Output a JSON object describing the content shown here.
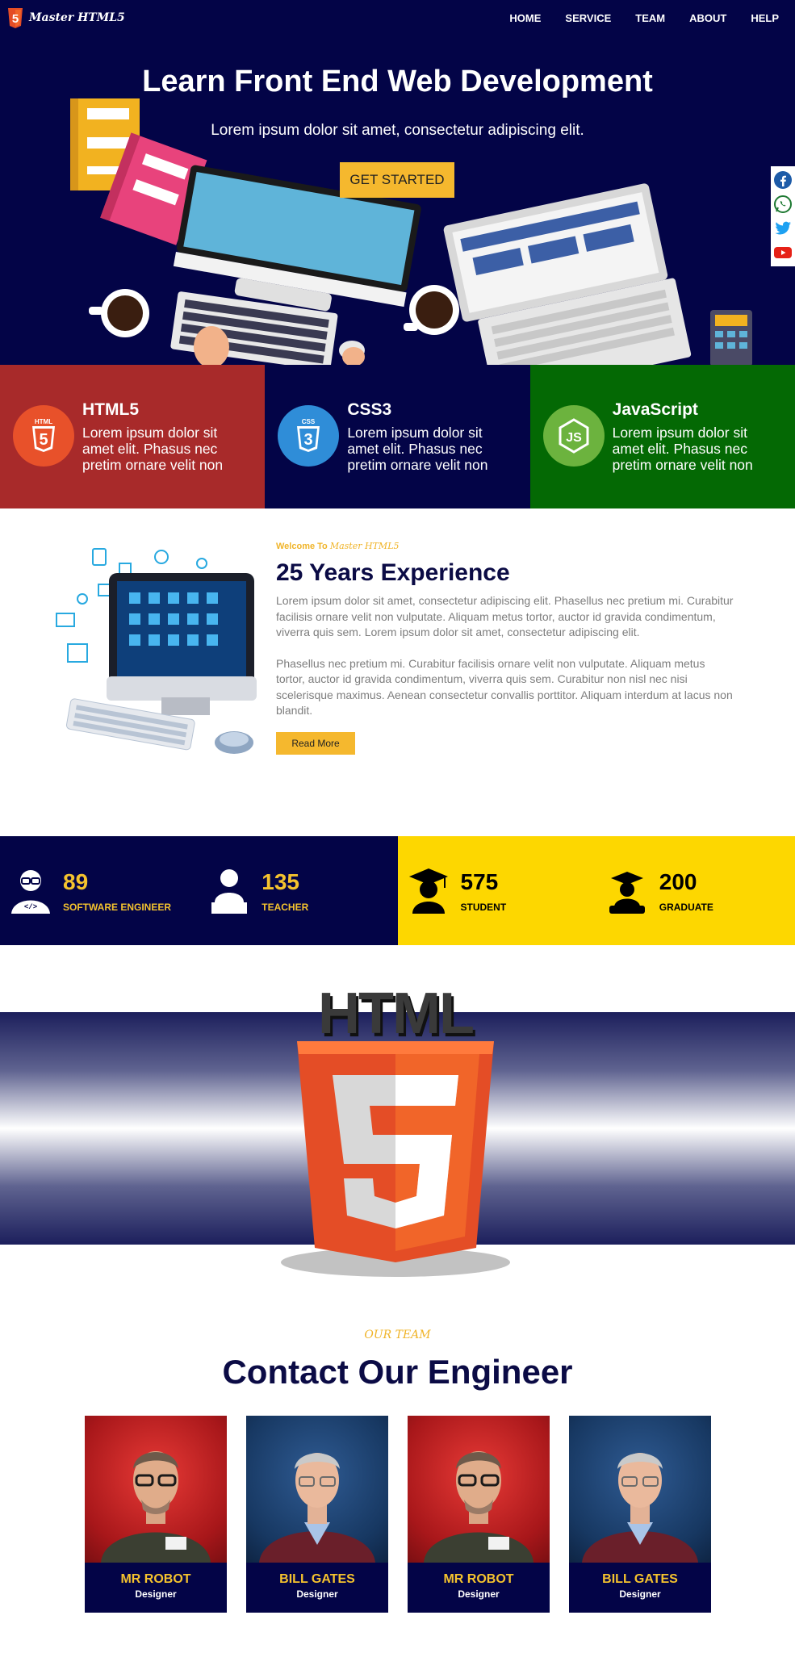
{
  "nav": {
    "brand": "Master HTML5",
    "items": [
      "HOME",
      "SERVICE",
      "TEAM",
      "ABOUT",
      "HELP"
    ]
  },
  "hero": {
    "title": "Learn Front End Web Development",
    "subtitle": "Lorem ipsum dolor sit amet, consectetur adipiscing elit.",
    "cta": "GET STARTED"
  },
  "social": [
    "facebook-icon",
    "whatsapp-icon",
    "twitter-icon",
    "youtube-icon"
  ],
  "features": [
    {
      "title": "HTML5",
      "text": "Lorem ipsum dolor sit amet elit. Phasus nec pretim ornare velit non",
      "bg": "#a82a2a",
      "icon": "html5-icon"
    },
    {
      "title": "CSS3",
      "text": "Lorem ipsum dolor sit amet elit. Phasus nec pretim ornare velit non",
      "bg": "#030447",
      "icon": "css3-icon"
    },
    {
      "title": "JavaScript",
      "text": "Lorem ipsum dolor sit amet elit. Phasus nec pretim ornare velit non",
      "bg": "#046904",
      "icon": "nodejs-icon"
    }
  ],
  "about": {
    "welcome": "Welcome To",
    "welcome_brand": "Master HTML5",
    "title": "25 Years Experience",
    "p1": "Lorem ipsum dolor sit amet, consectetur adipiscing elit. Phasellus nec pretium mi. Curabitur facilisis ornare velit non vulputate. Aliquam metus tortor, auctor id gravida condimentum, viverra quis sem. Lorem ipsum dolor sit amet, consectetur adipiscing elit.",
    "p2": "Phasellus nec pretium mi. Curabitur facilisis ornare velit non vulputate. Aliquam metus tortor, auctor id gravida condimentum, viverra quis sem. Curabitur non nisl nec nisi scelerisque maximus. Aenean consectetur convallis porttitor. Aliquam interdum at lacus non blandit.",
    "button": "Read More"
  },
  "stats": [
    {
      "number": "89",
      "label": "SOFTWARE ENGINEER",
      "icon": "engineer-icon"
    },
    {
      "number": "135",
      "label": "TEACHER",
      "icon": "teacher-icon"
    },
    {
      "number": "575",
      "label": "STUDENT",
      "icon": "student-icon"
    },
    {
      "number": "200",
      "label": "GRADUATE",
      "icon": "graduate-icon"
    }
  ],
  "banner": {
    "wordmark": "HTML"
  },
  "team": {
    "eyebrow": "OUR TEAM",
    "title": "Contact Our Engineer",
    "members": [
      {
        "name": "MR ROBOT",
        "role": "Designer",
        "bg": "red"
      },
      {
        "name": "BILL GATES",
        "role": "Designer",
        "bg": "blue"
      },
      {
        "name": "MR ROBOT",
        "role": "Designer",
        "bg": "red"
      },
      {
        "name": "BILL GATES",
        "role": "Designer",
        "bg": "blue"
      }
    ]
  },
  "colors": {
    "navy": "#030447",
    "yellow": "#f5b82e",
    "stat_yellow": "#fdd700",
    "html_red": "#a82a2a",
    "js_green": "#046904"
  }
}
